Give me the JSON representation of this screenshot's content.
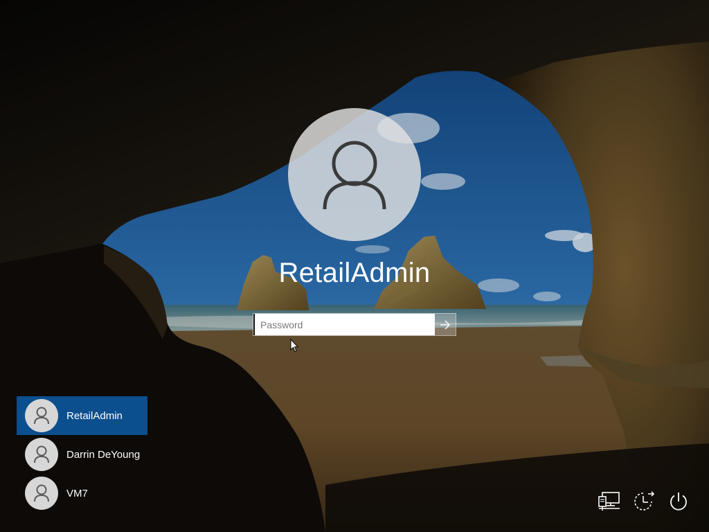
{
  "login": {
    "username": "RetailAdmin",
    "password_placeholder": "Password",
    "password_value": ""
  },
  "user_list": [
    {
      "name": "RetailAdmin",
      "selected": true
    },
    {
      "name": "Darrin DeYoung",
      "selected": false
    },
    {
      "name": "VM7",
      "selected": false
    }
  ],
  "corner_icons": [
    "network-icon",
    "ease-of-access-icon",
    "power-icon"
  ],
  "colors": {
    "selected_user_bg": "#0b4f8e",
    "avatar_bg": "#e2e2e2",
    "text": "#ffffff"
  }
}
